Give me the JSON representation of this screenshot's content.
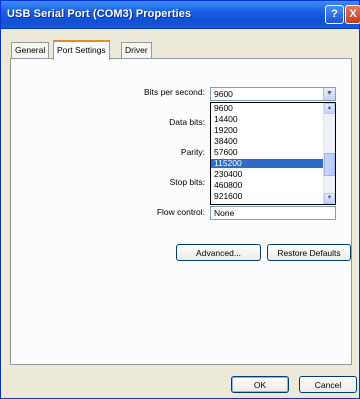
{
  "window": {
    "title": "USB Serial Port (COM3) Properties",
    "help_label": "?",
    "close_label": "X"
  },
  "tabs": [
    {
      "label": "General",
      "active": false
    },
    {
      "label": "Port Settings",
      "active": true
    },
    {
      "label": "Driver",
      "active": false
    }
  ],
  "fields": {
    "bits_per_second": {
      "label": "Bits per second:",
      "value": "9600"
    },
    "data_bits": {
      "label": "Data bits:"
    },
    "parity": {
      "label": "Parity:"
    },
    "stop_bits": {
      "label": "Stop bits:"
    },
    "flow_control": {
      "label": "Flow control:",
      "value": "None"
    }
  },
  "baud_options": [
    "9600",
    "14400",
    "19200",
    "38400",
    "57600",
    "115200",
    "230400",
    "460800",
    "921600"
  ],
  "baud_highlighted": "115200",
  "buttons": {
    "advanced": "Advanced...",
    "restore_defaults": "Restore Defaults",
    "ok": "OK",
    "cancel": "Cancel"
  },
  "icons": {
    "dropdown": "chevron-down-icon",
    "scroll_up": "chevron-up-icon",
    "scroll_down": "chevron-down-icon"
  },
  "colors": {
    "titlebar": "#1a5fe0",
    "selection": "#316ac5",
    "dialog_bg": "#ece9d8"
  }
}
